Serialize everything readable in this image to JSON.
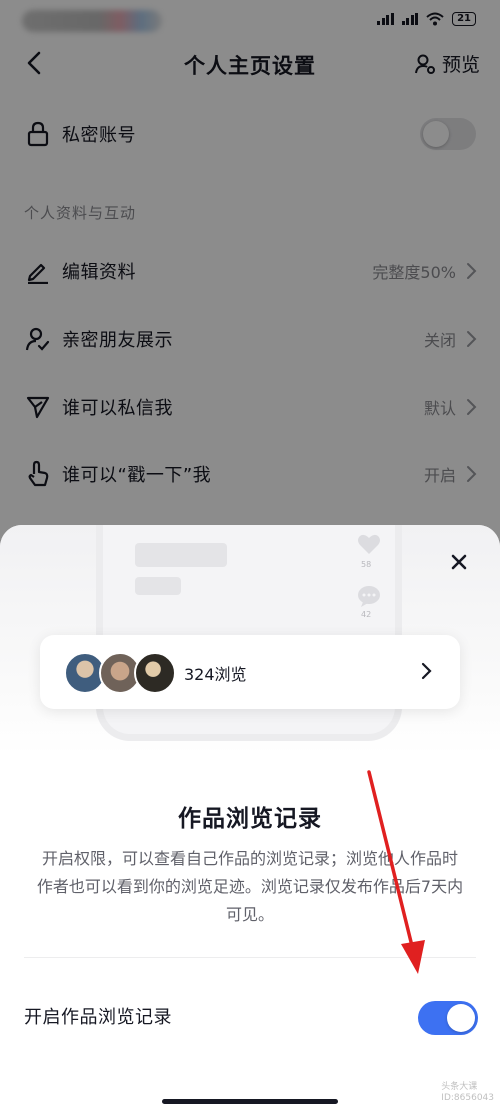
{
  "nav": {
    "title": "个人主页设置",
    "preview_label": "预览"
  },
  "status": {
    "battery": "21"
  },
  "private_account": {
    "label": "私密账号",
    "enabled": false
  },
  "section_title": "个人资料与互动",
  "settings_rows": [
    {
      "label": "编辑资料",
      "value": "完整度50%"
    },
    {
      "label": "亲密朋友展示",
      "value": "关闭"
    },
    {
      "label": "谁可以私信我",
      "value": "默认"
    },
    {
      "label": "谁可以“戳一下”我",
      "value": "开启"
    }
  ],
  "sheet": {
    "illustration": {
      "likes": "58",
      "comments": "42"
    },
    "card_views": "324浏览",
    "title": "作品浏览记录",
    "description": "开启权限，可以查看自己作品的浏览记录；浏览他人作品时作者也可以看到你的浏览足迹。浏览记录仅发布作品后7天内可见。",
    "toggle_label": "开启作品浏览记录",
    "toggle_enabled": true,
    "watermark_line1": "头条大课",
    "watermark_line2": "ID:8656043"
  },
  "colors": {
    "accent": "#3d71f2",
    "annotation_arrow": "#e02020"
  }
}
